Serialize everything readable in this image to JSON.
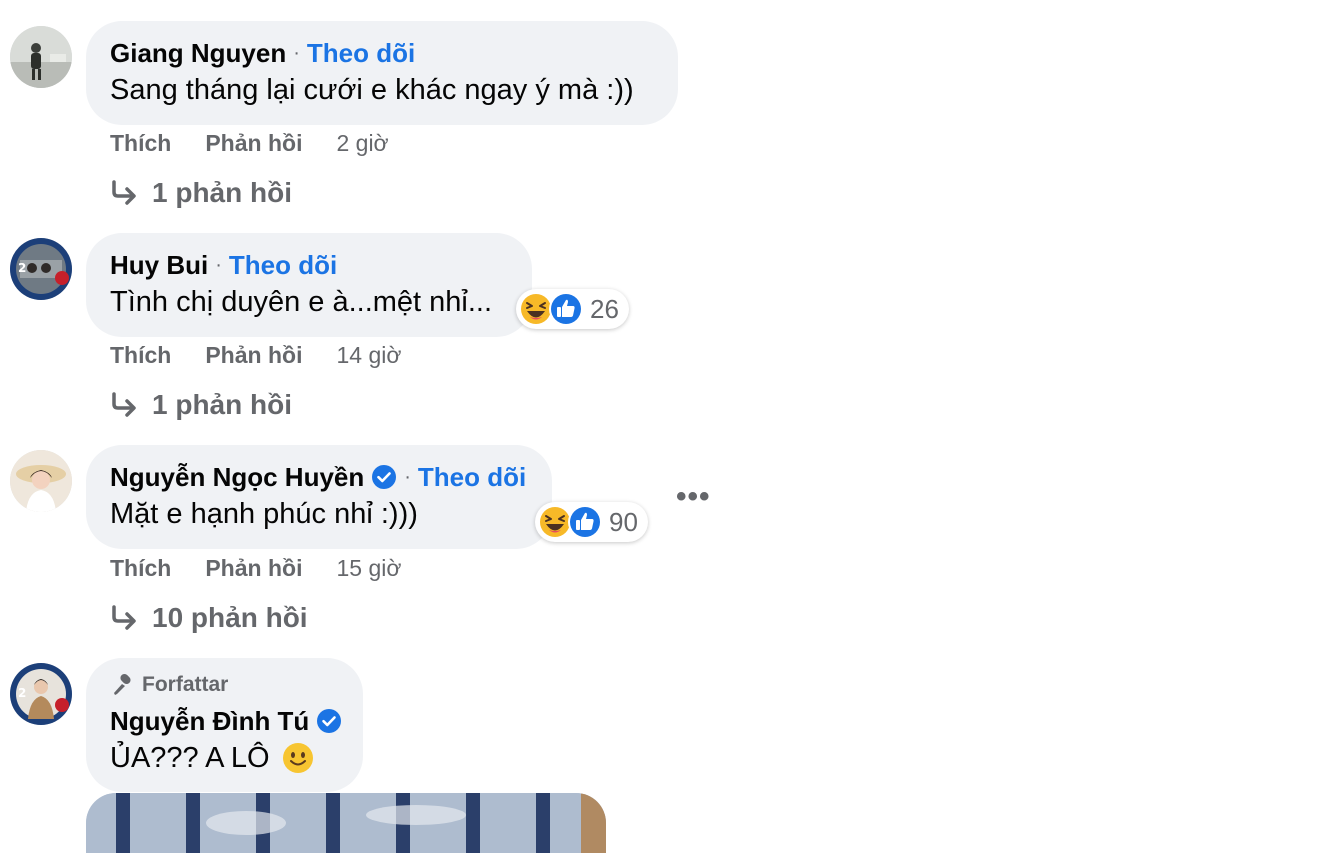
{
  "comments": [
    {
      "author": "Giang Nguyen",
      "follow_label": "Theo dõi",
      "separator": "·",
      "text": "Sang tháng lại cưới e khác ngay ý mà :))",
      "like_label": "Thích",
      "reply_label": "Phản hồi",
      "time": "2 giờ",
      "replies_label": "1 phản hồi"
    },
    {
      "author": "Huy Bui",
      "follow_label": "Theo dõi",
      "separator": "·",
      "text": "Tình chị duyên e à...mệt nhỉ...",
      "reaction_count": "26",
      "reactions": [
        "haha-icon",
        "like-icon"
      ],
      "like_label": "Thích",
      "reply_label": "Phản hồi",
      "time": "14 giờ",
      "replies_label": "1 phản hồi"
    },
    {
      "author": "Nguyễn Ngọc Huyền",
      "follow_label": "Theo dõi",
      "separator": "·",
      "text": "Mặt e hạnh phúc nhỉ :)))",
      "reaction_count": "90",
      "reactions": [
        "haha-icon",
        "like-icon"
      ],
      "more_label": "•••",
      "like_label": "Thích",
      "reply_label": "Phản hồi",
      "time": "15 giờ",
      "replies_label": "10 phản hồi"
    },
    {
      "badge": "Forfattar",
      "author": "Nguyễn Đình Tú",
      "text": "ỦA??? A LÔ"
    }
  ],
  "colors": {
    "bubble": "#f0f2f5",
    "link": "#1b74e4",
    "secondary_text": "#65676b",
    "verified": "#1b74e4"
  }
}
